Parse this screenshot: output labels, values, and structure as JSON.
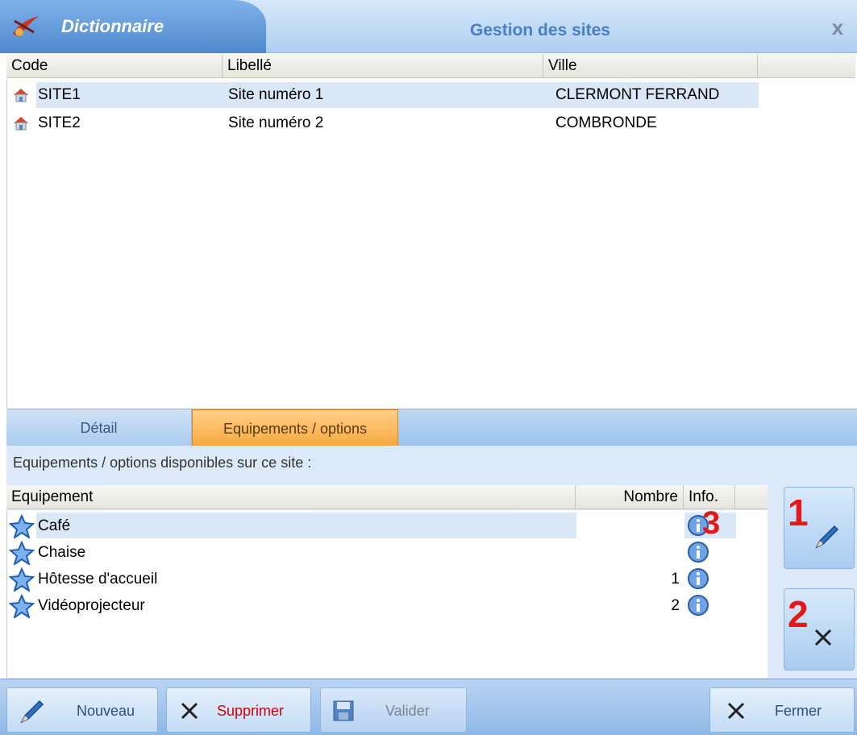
{
  "window": {
    "tab_label": "Dictionnaire",
    "title": "Gestion des sites",
    "close_label": "x"
  },
  "sites_table": {
    "columns": [
      "Code",
      "Libellé",
      "Ville"
    ],
    "rows": [
      {
        "code": "SITE1",
        "libelle": "Site numéro 1",
        "ville": "CLERMONT FERRAND",
        "selected": true
      },
      {
        "code": "SITE2",
        "libelle": "Site numéro 2",
        "ville": "COMBRONDE",
        "selected": false
      }
    ]
  },
  "tabs": [
    {
      "label": "Détail",
      "active": false
    },
    {
      "label": "Equipements / options",
      "active": true
    }
  ],
  "equipments": {
    "caption": "Equipements / options disponibles sur ce site :",
    "columns": [
      "Equipement",
      "Nombre",
      "Info."
    ],
    "rows": [
      {
        "name": "Café",
        "nombre": "",
        "selected": true
      },
      {
        "name": "Chaise",
        "nombre": ""
      },
      {
        "name": "Hôtesse d'accueil",
        "nombre": "1"
      },
      {
        "name": "Vidéoprojecteur",
        "nombre": "2"
      }
    ]
  },
  "annotations": [
    "1",
    "2",
    "3"
  ],
  "toolbar": {
    "new_label": "Nouveau",
    "delete_label": "Supprimer",
    "validate_label": "Valider",
    "close_label": "Fermer"
  },
  "colors": {
    "accent_blue": "#4e88cc",
    "active_tab": "#f7a93f",
    "selection": "#dae7f7",
    "annotation_red": "#e31818",
    "delete_red": "#cc0000"
  }
}
